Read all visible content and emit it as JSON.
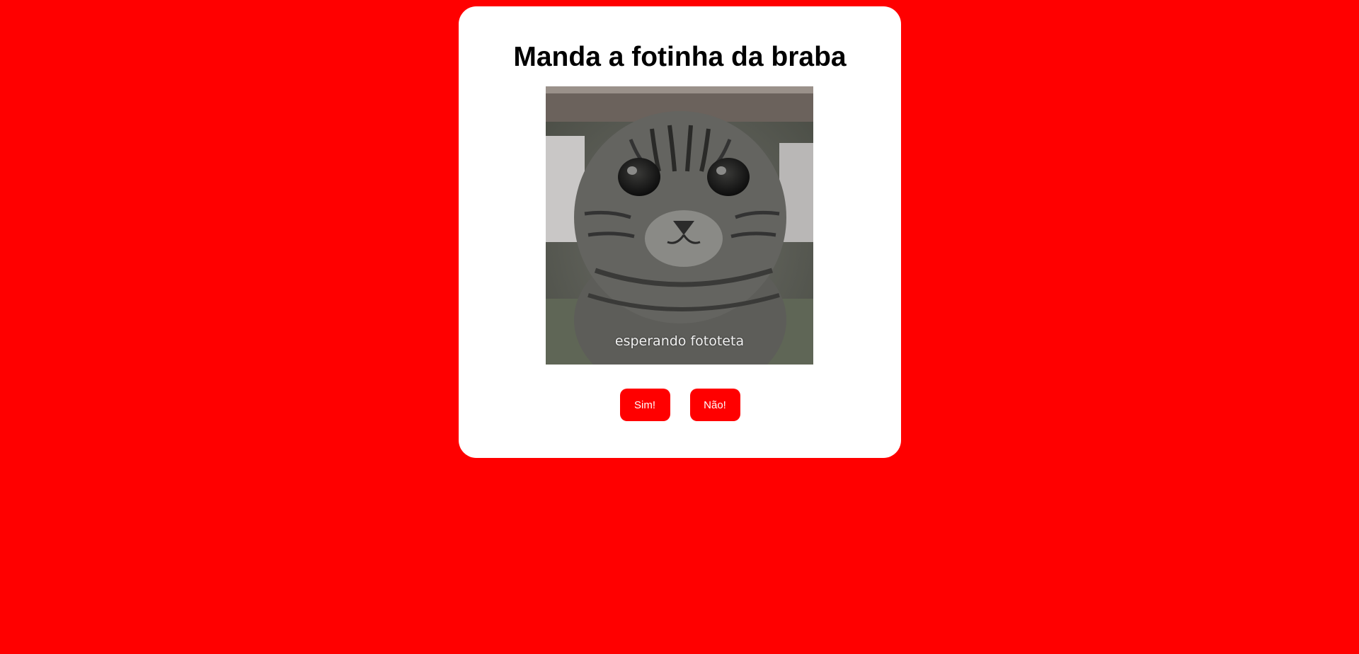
{
  "page": {
    "background_color": "#ff0000"
  },
  "card": {
    "title": "Manda a fotinha da braba",
    "image": {
      "subject": "tabby-cat-meme",
      "caption": "esperando fototeta"
    },
    "buttons": {
      "yes_label": "Sim!",
      "no_label": "Não!"
    }
  },
  "colors": {
    "accent": "#ff0000",
    "card_bg": "#ffffff",
    "title_text": "#000000",
    "button_text": "#ffffff"
  }
}
